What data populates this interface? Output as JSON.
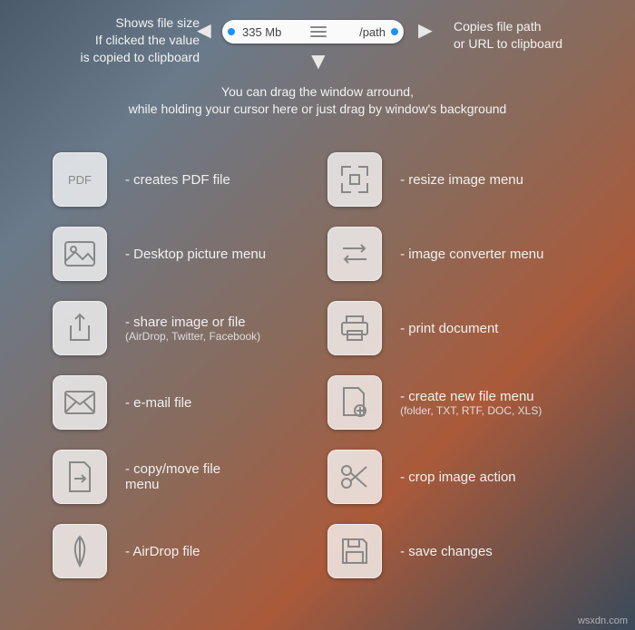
{
  "topbar": {
    "size": "335 Mb",
    "path": "/path"
  },
  "anno_left": "Shows file size\nIf clicked the value\nis copied to clipboard",
  "anno_right": "Copies file path\nor URL to clipboard",
  "anno_center": "You can drag the window arround,\nwhile holding your cursor here or just drag by window's background",
  "left_col": [
    {
      "icon": "pdf",
      "label": "- creates PDF file",
      "sub": ""
    },
    {
      "icon": "picture",
      "label": "- Desktop picture menu",
      "sub": ""
    },
    {
      "icon": "share",
      "label": "- share image or file",
      "sub": "(AirDrop, Twitter, Facebook)"
    },
    {
      "icon": "email",
      "label": "- e-mail file",
      "sub": ""
    },
    {
      "icon": "copymove",
      "label": "- copy/move file\n        menu",
      "sub": ""
    },
    {
      "icon": "airdrop",
      "label": "- AirDrop file",
      "sub": ""
    }
  ],
  "right_col": [
    {
      "icon": "resize",
      "label": "- resize image menu",
      "sub": ""
    },
    {
      "icon": "convert",
      "label": "- image converter menu",
      "sub": ""
    },
    {
      "icon": "print",
      "label": "- print document",
      "sub": ""
    },
    {
      "icon": "newfile",
      "label": "- create new file menu",
      "sub": "(folder, TXT, RTF, DOC, XLS)"
    },
    {
      "icon": "crop",
      "label": "- crop image action",
      "sub": ""
    },
    {
      "icon": "save",
      "label": "- save changes",
      "sub": ""
    }
  ],
  "watermark": "wsxdn.com"
}
